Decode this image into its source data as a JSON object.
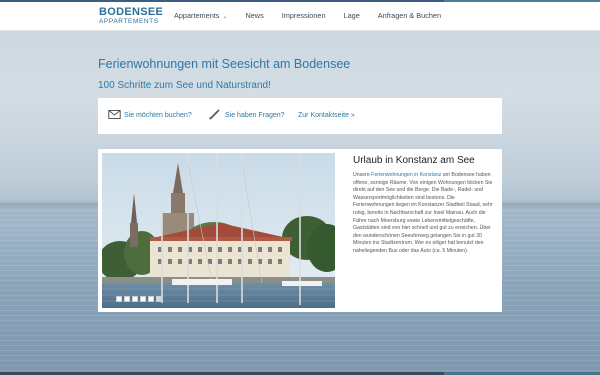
{
  "logo": {
    "main": "BODENSEE",
    "sub": "APPARTEMENTS"
  },
  "nav": {
    "items": [
      {
        "label": "Appartements",
        "has_dropdown": true
      },
      {
        "label": "News"
      },
      {
        "label": "Impressionen"
      },
      {
        "label": "Lage"
      },
      {
        "label": "Anfragen & Buchen"
      }
    ],
    "caret": "⌄"
  },
  "hero": {
    "title": "Ferienwohnungen mit Seesicht am Bodensee",
    "subtitle": "100 Schritte zum See und Naturstrand!"
  },
  "contact": {
    "book_label": "Sie möchten buchen?",
    "questions_label": "Sie haben Fragen?",
    "contact_link": "Zur Kontaktseite »"
  },
  "slider": {
    "slide_count": 6,
    "active_index": 5
  },
  "article": {
    "title": "Urlaub in Konstanz am See",
    "lead": "Unsere ",
    "link_text": "Ferienwohnungen in Konstanz",
    "body": " am Bodensee haben offene, sonnige Räume. Von einigen Wohnungen blicken Sie direkt auf den See und die Berge. Die Bade-, Radel- und Wassersportmöglichkeiten sind bestens. Die Ferienwohnungen liegen im Konstanzer Stadtteil Staad, sehr ruhig, bereits in Nachbarschaft zur Insel Mainau. Auch die Fähre nach Meersburg sowie Lebensmittelgeschäfte, Gaststätten sind von hier schnell und gut zu erreichen. Über den wunderschönen Seeuferweg gelangen Sie in gut 30 Minuten ins Stadtzentrum. Wer es eiliger hat benutzt den naheliegenden Bus oder das Auto (ca. 5 Minuten)."
  },
  "colors": {
    "accent": "#2e78a8",
    "nav_text": "#3a4b5c",
    "top_stripe": "#3b5d80"
  }
}
